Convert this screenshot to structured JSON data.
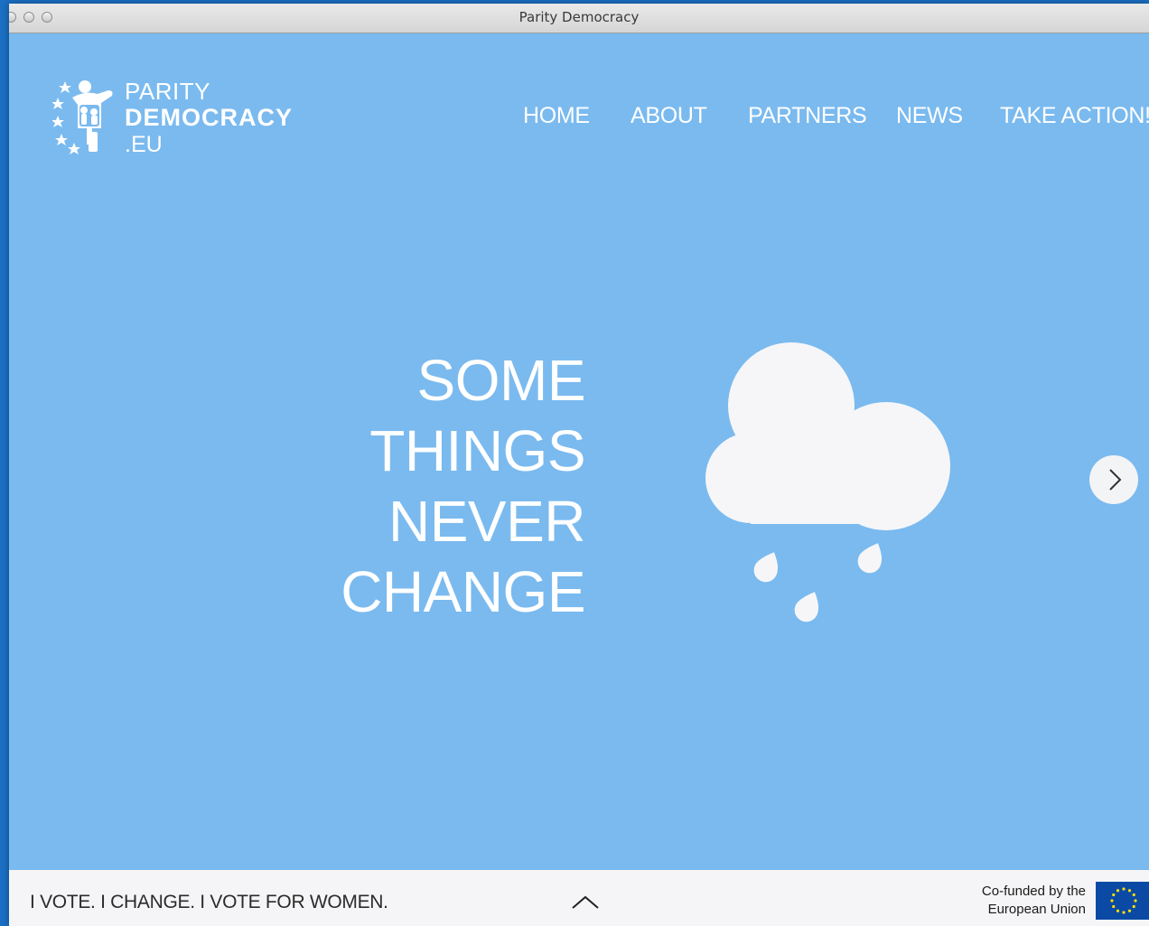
{
  "window": {
    "title": "Parity Democracy"
  },
  "logo": {
    "line1": "PARITY",
    "line2": "DEMOCRACY",
    "line3": ".EU"
  },
  "nav": {
    "items": [
      {
        "label": "HOME"
      },
      {
        "label": "ABOUT"
      },
      {
        "label": "PARTNERS"
      },
      {
        "label": "NEWS"
      },
      {
        "label": "TAKE ACTION!"
      }
    ]
  },
  "hero": {
    "lines": [
      "SOME",
      "THINGS",
      "NEVER",
      "CHANGE"
    ],
    "illustration": "rain-cloud-icon",
    "next_icon": "chevron-right-icon"
  },
  "footer": {
    "slogan": "I VOTE. I CHANGE. I VOTE FOR WOMEN.",
    "scroll_icon": "chevron-up-icon",
    "funding_line1": "Co-funded by the",
    "funding_line2": "European Union",
    "flag_icon": "eu-flag-icon"
  },
  "colors": {
    "page_background": "#7abaef",
    "footer_background": "#f5f5f7",
    "text_light": "#ffffff",
    "eu_flag_blue": "#0a4aa5",
    "eu_flag_stars": "#ffdd00"
  }
}
